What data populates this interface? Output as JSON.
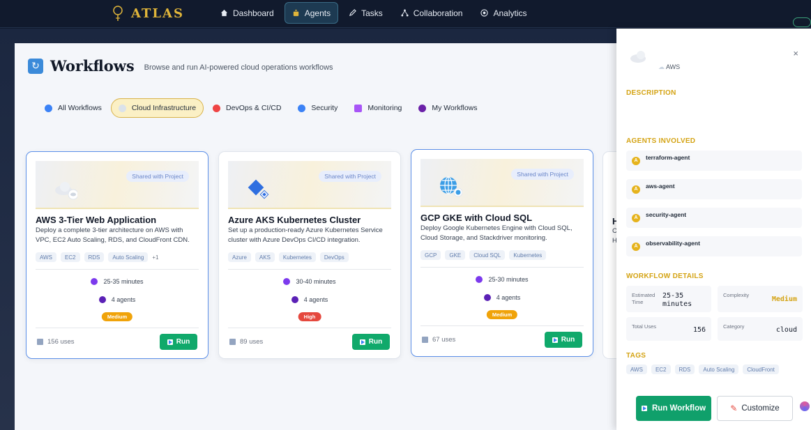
{
  "app": {
    "name": "ATLAS",
    "nav": [
      {
        "label": "Dashboard",
        "icon": "home-icon"
      },
      {
        "label": "Agents",
        "icon": "robot-icon",
        "active": true
      },
      {
        "label": "Tasks",
        "icon": "pencil-icon"
      },
      {
        "label": "Collaboration",
        "icon": "network-icon"
      },
      {
        "label": "Analytics",
        "icon": "target-icon"
      }
    ]
  },
  "page": {
    "title": "Workflows",
    "subtitle": "Browse and run AI-powered cloud operations workflows"
  },
  "categories": [
    {
      "label": "All Workflows",
      "icon": "globe-icon",
      "color": "#3b82f6"
    },
    {
      "label": "Cloud Infrastructure",
      "icon": "cloud-icon",
      "color": "#cbd5e1",
      "active": true
    },
    {
      "label": "DevOps & CI/CD",
      "icon": "rocket-icon",
      "color": "#ef4444"
    },
    {
      "label": "Security",
      "icon": "shield-icon",
      "color": "#3b82f6"
    },
    {
      "label": "Monitoring",
      "icon": "chart-icon",
      "color": "#a855f7"
    },
    {
      "label": "My Workflows",
      "icon": "person-icon",
      "color": "#6b21a8"
    }
  ],
  "cards": [
    {
      "title": "AWS 3-Tier Web Application",
      "description": "Deploy a complete 3-tier architecture on AWS with VPC, EC2 Auto Scaling, RDS, and CloudFront CDN.",
      "shared": "Shared with Project",
      "tags": [
        "AWS",
        "EC2",
        "RDS",
        "Auto Scaling"
      ],
      "more": "+1",
      "duration": "25-35 minutes",
      "agents": "4 agents",
      "complexity": "Medium",
      "complexity_color": "#f0a30a",
      "uses": "156 uses",
      "run": "Run",
      "icon": "cloud-icon"
    },
    {
      "title": "Azure AKS Kubernetes Cluster",
      "description": "Set up a production-ready Azure Kubernetes Service cluster with Azure DevOps CI/CD integration.",
      "shared": "Shared with Project",
      "tags": [
        "Azure",
        "AKS",
        "Kubernetes",
        "DevOps"
      ],
      "more": "",
      "duration": "30-40 minutes",
      "agents": "4 agents",
      "complexity": "High",
      "complexity_color": "#e5483e",
      "uses": "89 uses",
      "run": "Run",
      "icon": "diamond-icon"
    },
    {
      "title": "GCP GKE with Cloud SQL",
      "description": "Deploy Google Kubernetes Engine with Cloud SQL, Cloud Storage, and Stackdriver monitoring.",
      "shared": "Shared with Project",
      "tags": [
        "GCP",
        "GKE",
        "Cloud SQL",
        "Kubernetes"
      ],
      "more": "",
      "duration": "25-30 minutes",
      "agents": "4 agents",
      "complexity": "Medium",
      "complexity_color": "#f0a30a",
      "uses": "67 uses",
      "run": "Run",
      "icon": "globe-icon"
    }
  ],
  "partial_card": {
    "title_initial": "H",
    "desc_initial_1": "C",
    "desc_initial_2": "H"
  },
  "detail": {
    "provider": "AWS",
    "close": "×",
    "description_heading": "DESCRIPTION",
    "agents_heading": "AGENTS INVOLVED",
    "agents": [
      "terraform-agent",
      "aws-agent",
      "security-agent",
      "observability-agent"
    ],
    "details_heading": "WORKFLOW DETAILS",
    "estimated_time_label": "Estimated Time",
    "estimated_time_value": "25-35 minutes",
    "complexity_label": "Complexity",
    "complexity_value": "Medium",
    "total_uses_label": "Total Uses",
    "total_uses_value": "156",
    "category_label": "Category",
    "category_value": "cloud",
    "tags_heading": "TAGS",
    "tags": [
      "AWS",
      "EC2",
      "RDS",
      "Auto Scaling",
      "CloudFront"
    ],
    "run_label": "Run Workflow",
    "customize_label": "Customize"
  }
}
